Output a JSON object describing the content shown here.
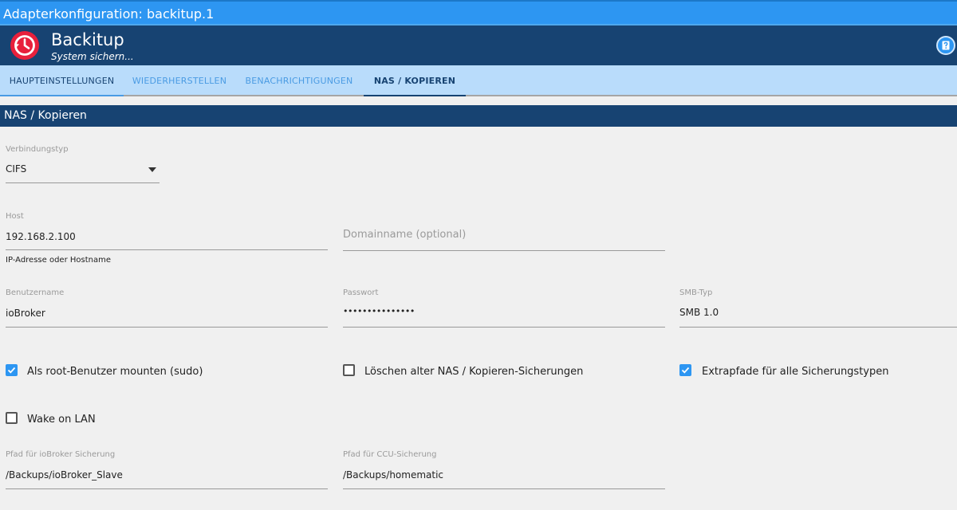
{
  "window": {
    "title": "Adapterkonfiguration: backitup.1"
  },
  "app": {
    "name": "Backitup",
    "subtitle": "System sichern..."
  },
  "tabs": [
    {
      "label": "HAUPTEINSTELLUNGEN",
      "active": false
    },
    {
      "label": "WIEDERHERSTELLEN",
      "active": false
    },
    {
      "label": "BENACHRICHTIGUNGEN",
      "active": false
    },
    {
      "label": "NAS / KOPIEREN",
      "active": true
    }
  ],
  "section": {
    "title": "NAS / Kopieren"
  },
  "form": {
    "connection_type": {
      "label": "Verbindungstyp",
      "value": "CIFS"
    },
    "host": {
      "label": "Host",
      "value": "192.168.2.100",
      "helper": "IP-Adresse oder Hostname"
    },
    "domain": {
      "placeholder": "Domainname (optional)"
    },
    "username": {
      "label": "Benutzername",
      "value": "ioBroker"
    },
    "password": {
      "label": "Passwort",
      "value": "•••••••••••••••"
    },
    "smb_type": {
      "label": "SMB-Typ",
      "value": "SMB 1.0"
    },
    "mount_root": {
      "label": "Als root-Benutzer mounten (sudo)",
      "checked": true
    },
    "delete_old": {
      "label": "Löschen alter NAS / Kopieren-Sicherungen",
      "checked": false
    },
    "extra_paths": {
      "label": "Extrapfade für alle Sicherungstypen",
      "checked": true
    },
    "wake_on_lan": {
      "label": "Wake on LAN",
      "checked": false
    },
    "iobroker_path": {
      "label": "Pfad für ioBroker Sicherung",
      "value": "/Backups/ioBroker_Slave"
    },
    "ccu_path": {
      "label": "Pfad für CCU-Sicherung",
      "value": "/Backups/homematic"
    }
  },
  "colors": {
    "accent": "#2d96f2",
    "header": "#174372",
    "tabs_bg": "#b9dcfb",
    "logo": "#e8203c"
  }
}
